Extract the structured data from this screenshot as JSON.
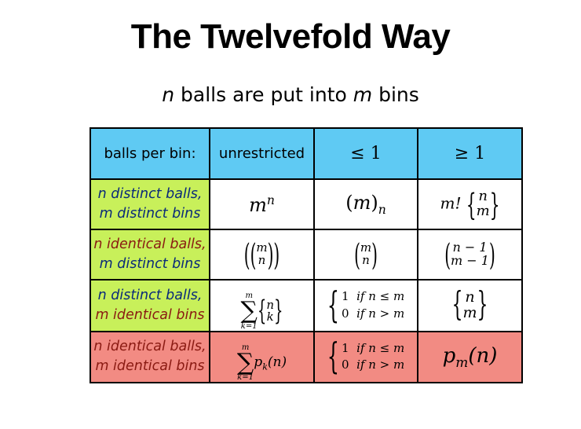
{
  "title": "The Twelvefold Way",
  "subtitle": {
    "var_n": "n",
    "middle": "balls are put into",
    "var_m": "m",
    "end": "bins"
  },
  "table": {
    "header": {
      "label": "balls per bin:",
      "c1": "unrestricted",
      "c2": "≤ 1",
      "c3": "≥ 1"
    },
    "rows": [
      {
        "line1": "n distinct balls,",
        "line2": "m distinct bins",
        "c1": {
          "base": "m",
          "exp": "n"
        },
        "c2": {
          "open": "(",
          "var": "m",
          "close": ")",
          "sub": "n"
        },
        "c3": {
          "prefix": "m!",
          "top": "n",
          "bottom": "m"
        }
      },
      {
        "line1": "n identical balls,",
        "line2": "m distinct bins",
        "c1": {
          "top": "m",
          "bottom": "n"
        },
        "c2": {
          "top": "m",
          "bottom": "n"
        },
        "c3": {
          "top": "n − 1",
          "bottom": "m − 1"
        }
      },
      {
        "line1": "n distinct balls,",
        "line2": "m identical bins",
        "c1": {
          "upper": "m",
          "lower": "k=1",
          "top": "n",
          "bottom": "k"
        },
        "c2": {
          "case1_val": "1",
          "case1_cond": "if n ≤ m",
          "case2_val": "0",
          "case2_cond": "if n > m"
        },
        "c3": {
          "top": "n",
          "bottom": "m"
        }
      },
      {
        "line1": "n identical balls,",
        "line2": "m identical bins",
        "c1": {
          "upper": "m",
          "lower": "k=1",
          "term": "p",
          "term_sub": "k",
          "arg": "(n)"
        },
        "c2": {
          "case1_val": "1",
          "case1_cond": "if n ≤ m",
          "case2_val": "0",
          "case2_cond": "if n > m"
        },
        "c3": {
          "term": "p",
          "term_sub": "m",
          "arg": "(n)"
        }
      }
    ]
  },
  "colors": {
    "header": "#5fcaf3",
    "label_green": "#c8f05a",
    "row_red": "#f28b83",
    "text_blue": "#0a2a7a",
    "text_red": "#8a1a12"
  }
}
